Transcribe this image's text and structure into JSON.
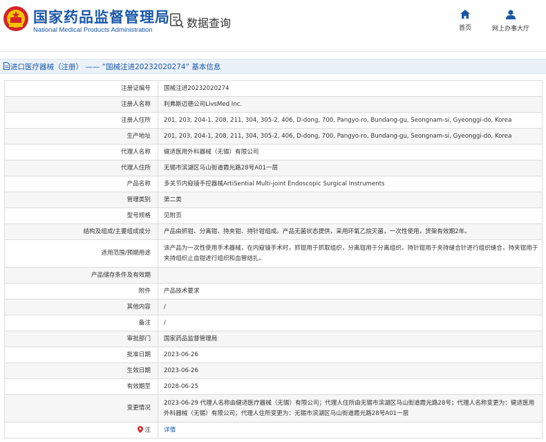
{
  "header": {
    "org_name_cn": "国家药品监督管理局",
    "org_name_en": "National Medical Products Administration",
    "query_title": "数据查询",
    "nav": [
      {
        "label": "首页",
        "icon": "home-icon"
      },
      {
        "label": "网上办事大厅",
        "icon": "user-icon"
      }
    ]
  },
  "page_title": "进口医疗器械（注册） ——  “国械注进20232020274”  基本信息",
  "rows": [
    {
      "label": "注册证编号",
      "value": "国械注进20232020274"
    },
    {
      "label": "注册人名称",
      "value": "利弗斯迈德公司LivsMed Inc."
    },
    {
      "label": "注册人住所",
      "value": "201, 203, 204-1, 208, 211, 304, 305-2, 406, D-dong, 700, Pangyo-ro, Bundang-gu, Seongnam-si, Gyeonggi-do, Korea"
    },
    {
      "label": "生产地址",
      "value": "201, 203, 204-1, 208, 211, 304, 305-2, 406, D-dong, 700, Pangyo-ro, Bundang-gu, Seongnam-si, Gyeonggi-do, Korea"
    },
    {
      "label": "代理人名称",
      "value": "健适医用外科器械（无锡）有限公司"
    },
    {
      "label": "代理人住所",
      "value": "无锡市滨湖区马山街道霞光路28号A01一层"
    },
    {
      "label": "产品名称",
      "value": "多关节内窥镜手控器械ArtiSential Multi-joint Endoscopic Surgical Instruments"
    },
    {
      "label": "管理类别",
      "value": "第二类"
    },
    {
      "label": "型号规格",
      "value": "见附页"
    },
    {
      "label": "结构及组成/主要组成成分",
      "value": "产品由抓钳、分离钳、持夹钳、持针钳组成。产品无菌状态提供，采用环氧乙烷灭菌，一次性使用，货架有效期2年。"
    },
    {
      "label": "适用范围/预期用途",
      "value": "该产品为一次性使用手术器械，在内窥镜手术时，抓钳用于抓取组织，分离钳用于分离组织，持针钳用于夹持缝合针进行组织缝合，持夹钳用于夹持组织止血钳进行组织和血管结扎。"
    },
    {
      "label": "产品储存条件及有效期",
      "value": ""
    },
    {
      "label": "附件",
      "value": "产品技术要求"
    },
    {
      "label": "其他内容",
      "value": "/"
    },
    {
      "label": "备注",
      "value": "/"
    },
    {
      "label": "审批部门",
      "value": "国家药品监督管理局"
    },
    {
      "label": "批准日期",
      "value": "2023-06-26"
    },
    {
      "label": "生效日期",
      "value": "2023-06-26"
    },
    {
      "label": "有效期至",
      "value": "2028-06-25"
    },
    {
      "label": "变更情况",
      "value": "2023-06-29 代理人名称由健适医疗器械（无锡）有限公司；代理人住所由无锡市滨湖区马山街道霞光路28号；代理人名称变更为：健适医用外科器械（无锡）有限公司；代理人住所变更为：无锡市滨湖区马山街道霞光路28号A01一层"
    },
    {
      "label": "注",
      "value": "详情",
      "link": true,
      "icon": "info-icon"
    }
  ],
  "colors": {
    "brand_blue": "#1a57a6",
    "emblem_red": "#d4232a",
    "emblem_gold": "#f5c400"
  }
}
